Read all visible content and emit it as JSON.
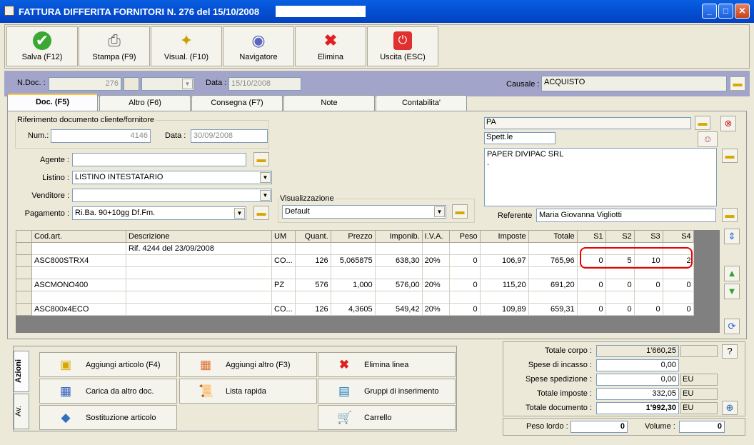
{
  "window": {
    "title": "FATTURA DIFFERITA FORNITORI N. 276  del 15/10/2008",
    "minimize": "_",
    "maximize": "□",
    "close": "✕"
  },
  "toolbar": {
    "save": "Salva (F12)",
    "print": "Stampa (F9)",
    "view": "Visual. (F10)",
    "navigator": "Navigatore",
    "delete": "Elimina",
    "exit": "Uscita (ESC)"
  },
  "header": {
    "ndoc_label": "N.Doc. :",
    "ndoc_value": "276",
    "data_label": "Data :",
    "data_value": "15/10/2008",
    "causale_label": "Causale :",
    "causale_value": "ACQUISTO"
  },
  "tabs": [
    "Doc. (F5)",
    "Altro (F6)",
    "Consegna (F7)",
    "Note",
    "Contabilita'"
  ],
  "riferimento": {
    "legend": "Riferimento documento cliente/fornitore",
    "num_label": "Num.:",
    "num_value": "4146",
    "data_label": "Data :",
    "data_value": "30/09/2008"
  },
  "form": {
    "agente_label": "Agente :",
    "agente_value": "",
    "listino_label": "Listino :",
    "listino_value": "LISTINO INTESTATARIO",
    "venditore_label": "Venditore :",
    "venditore_value": "",
    "pagamento_label": "Pagamento :",
    "pagamento_value": "Ri.Ba. 90+10gg Df.Fm.",
    "visual_legend": "Visualizzazione",
    "visual_value": "Default"
  },
  "party": {
    "code": "PA",
    "title": "Spett.le",
    "name": "PAPER DIVIPAC SRL",
    "name_line2": ".",
    "referente_label": "Referente",
    "referente_value": "Maria Giovanna Vigliotti"
  },
  "grid": {
    "columns": [
      "Cod.art.",
      "Descrizione",
      "UM",
      "Quant.",
      "Prezzo",
      "Imponib.",
      "I.V.A.",
      "Peso",
      "Imposte",
      "Totale",
      "S1",
      "S2",
      "S3",
      "S4"
    ],
    "rows": [
      [
        "",
        "Rif. 4244 del 23/09/2008",
        "",
        "",
        "",
        "",
        "",
        "",
        "",
        "",
        "",
        "",
        "",
        ""
      ],
      [
        "ASC800STRX4",
        "",
        "CO...",
        "126",
        "5,065875",
        "638,30",
        "20%",
        "0",
        "106,97",
        "765,96",
        "0",
        "5",
        "10",
        "2"
      ],
      [
        "",
        "",
        "",
        "",
        "",
        "",
        "",
        "",
        "",
        "",
        "",
        "",
        "",
        ""
      ],
      [
        "ASCMONO400",
        "",
        "PZ",
        "576",
        "1,000",
        "576,00",
        "20%",
        "0",
        "115,20",
        "691,20",
        "0",
        "0",
        "0",
        "0"
      ],
      [
        "",
        "",
        "",
        "",
        "",
        "",
        "",
        "",
        "",
        "",
        "",
        "",
        "",
        ""
      ],
      [
        "ASC800x4ECO",
        "",
        "CO...",
        "126",
        "4,3605",
        "549,42",
        "20%",
        "0",
        "109,89",
        "659,31",
        "0",
        "0",
        "0",
        "0"
      ]
    ]
  },
  "actions": {
    "tab_azioni": "Azioni",
    "tab_av": "Av.",
    "add_article": "Aggiungi articolo (F4)",
    "add_other": "Aggiungi altro (F3)",
    "delete_line": "Elimina linea",
    "load_from_doc": "Carica da altro doc.",
    "quick_list": "Lista rapida",
    "insert_groups": "Gruppi di inserimento",
    "substitute": "Sostituzione articolo",
    "cart": "Carrello"
  },
  "totals": {
    "corpo_label": "Totale corpo :",
    "corpo_value": "1'660,25",
    "help": "?",
    "incasso_label": "Spese di incasso :",
    "incasso_value": "0,00",
    "spedizione_label": "Spese spedizione :",
    "spedizione_value": "0,00",
    "spedizione_unit": "EU",
    "imposte_label": "Totale imposte :",
    "imposte_value": "332,05",
    "imposte_unit": "EU",
    "documento_label": "Totale documento :",
    "documento_value": "1'992,30",
    "documento_unit": "EU",
    "peso_label": "Peso lordo :",
    "peso_value": "0",
    "volume_label": "Volume :",
    "volume_value": "0"
  }
}
